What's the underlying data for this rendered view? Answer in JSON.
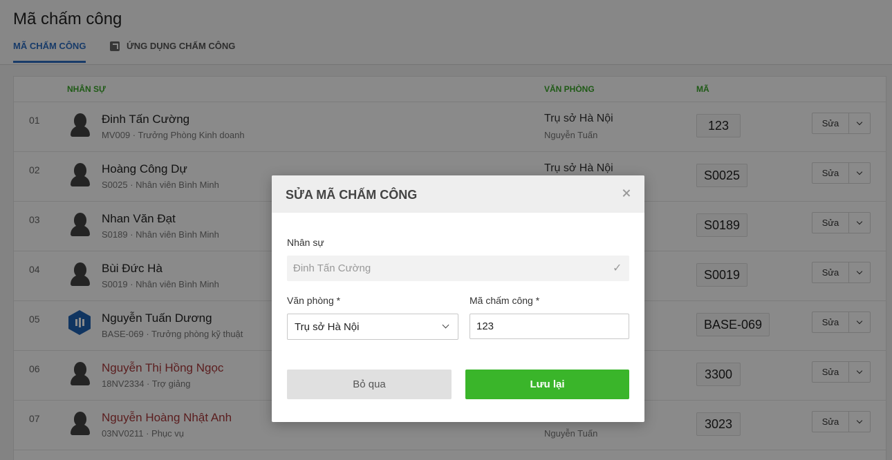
{
  "page": {
    "title": "Mã chấm công",
    "tabs": [
      {
        "label": "MÃ CHẤM CÔNG",
        "active": true
      },
      {
        "label": "ỨNG DỤNG CHẤM CÔNG",
        "icon": "external-link-icon"
      }
    ]
  },
  "table": {
    "columns": {
      "employee": "NHÂN SỰ",
      "office": "VĂN PHÒNG",
      "code": "MÃ"
    },
    "edit_label": "Sửa",
    "rows": [
      {
        "index": "01",
        "name": "Đinh Tấn Cường",
        "sub": "MV009 · Trưởng Phòng Kinh doanh",
        "office": "Trụ sở Hà Nội",
        "office_sub": "Nguyễn Tuấn",
        "code": "123",
        "name_color": "#222222"
      },
      {
        "index": "02",
        "name": "Hoàng Công Dự",
        "sub": "S0025 · Nhân viên Bình Minh",
        "office": "Trụ sở Hà Nội",
        "office_sub": "",
        "code": "S0025",
        "name_color": "#222222"
      },
      {
        "index": "03",
        "name": "Nhan Văn Đạt",
        "sub": "S0189 · Nhân viên Bình Minh",
        "office": "",
        "office_sub": "",
        "code": "S0189",
        "name_color": "#222222"
      },
      {
        "index": "04",
        "name": "Bùi Đức Hà",
        "sub": "S0019 · Nhân viên Bình Minh",
        "office": "",
        "office_sub": "",
        "code": "S0019",
        "name_color": "#222222"
      },
      {
        "index": "05",
        "name": "Nguyễn Tuấn Dương",
        "sub": "BASE-069 · Trưởng phòng kỹ thuật",
        "office": "",
        "office_sub": "",
        "code": "BASE-069",
        "name_color": "#222222",
        "avatar": "hex-logo"
      },
      {
        "index": "06",
        "name": "Nguyễn Thị Hồng Ngọc",
        "sub": "18NV2334 · Trợ giảng",
        "office": "",
        "office_sub": "",
        "code": "3300",
        "name_color": "#a9383a"
      },
      {
        "index": "07",
        "name": "Nguyễn Hoàng Nhật Anh",
        "sub": "03NV0211 · Phục vụ",
        "office": "",
        "office_sub": "Nguyễn Tuấn",
        "code": "3023",
        "name_color": "#a9383a"
      }
    ]
  },
  "modal": {
    "title": "SỬA MÃ CHẤM CÔNG",
    "employee_label": "Nhân sự",
    "employee_value": "Đinh Tấn Cường",
    "office_label": "Văn phòng *",
    "office_value": "Trụ sở Hà Nội",
    "code_label": "Mã chấm công *",
    "code_value": "123",
    "cancel_label": "Bỏ qua",
    "save_label": "Lưu lại",
    "colors": {
      "save": "#3ab52a",
      "accent": "#2d6ec2",
      "header_green": "#3aa72a"
    }
  }
}
